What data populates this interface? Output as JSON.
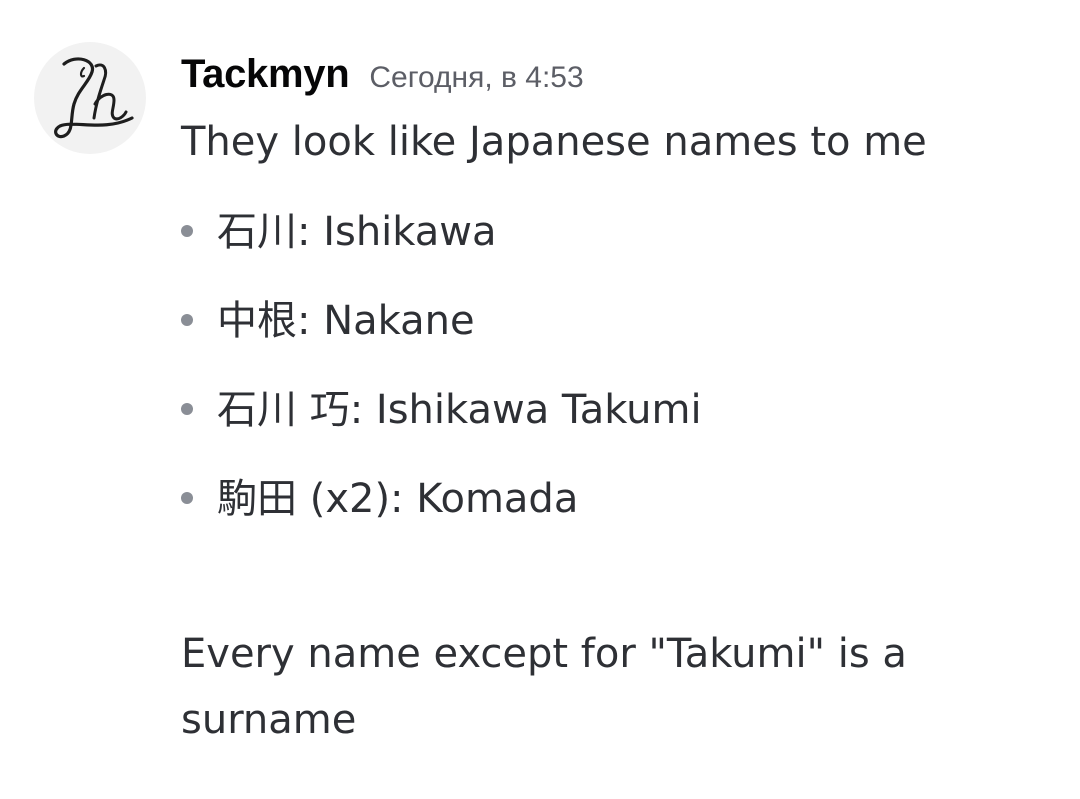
{
  "author": {
    "name": "Tackmyn",
    "timestamp": "Сегодня, в 4:53",
    "avatar_icon": "monogram-avatar-icon"
  },
  "message": {
    "intro": "They look like Japanese names to me",
    "items": [
      {
        "kanji": "石川",
        "reading": ": Ishikawa"
      },
      {
        "kanji": "中根",
        "reading": ": Nakane"
      },
      {
        "kanji": "石川 巧",
        "reading": ": Ishikawa Takumi"
      },
      {
        "kanji": "駒田",
        "reading": " (x2): Komada"
      }
    ],
    "outro": "Every name except for \"Takumi\" is a surname"
  },
  "colors": {
    "username": "#060607",
    "timestamp": "#5c5e66",
    "text": "#2e3035",
    "bullet": "#8a8e96",
    "avatar_bg": "#f2f2f2"
  }
}
